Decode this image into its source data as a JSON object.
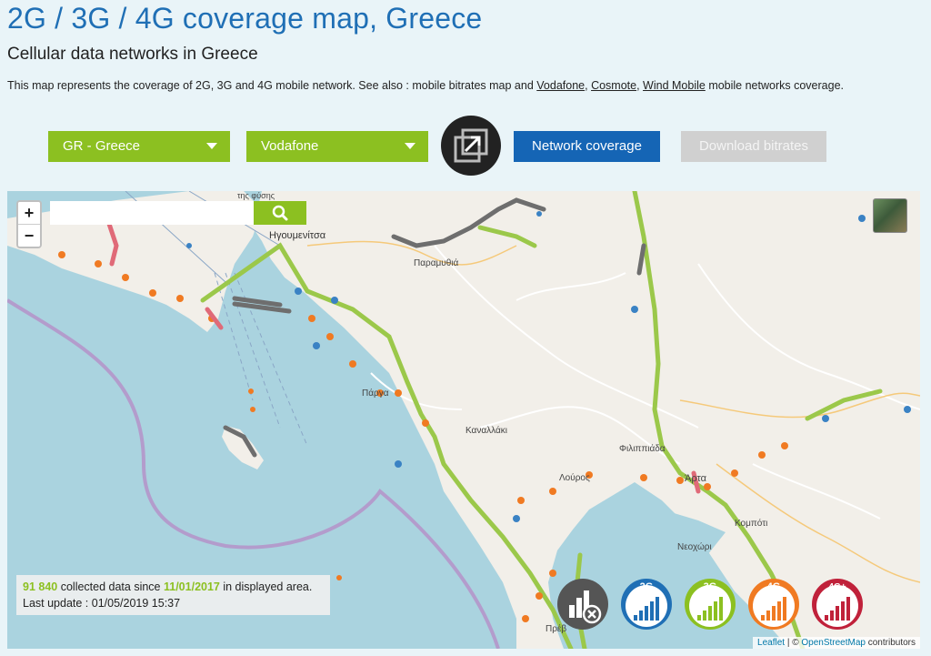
{
  "header": {
    "title": "2G / 3G / 4G coverage map, Greece",
    "subtitle": "Cellular data networks in Greece",
    "intro_text": "This map represents the coverage of 2G, 3G and 4G mobile network. See also : mobile bitrates map and",
    "intro_link_vodafone": "Vodafone",
    "intro_link_cosmote": "Cosmote",
    "intro_link_wind": "Wind Mobile",
    "intro_suffix": "mobile networks coverage."
  },
  "controls": {
    "country": "GR - Greece",
    "operator": "Vodafone",
    "network_coverage_label": "Network coverage",
    "download_bitrates_label": "Download bitrates"
  },
  "map": {
    "zoom_in": "+",
    "zoom_out": "−",
    "search_placeholder": "",
    "places": {
      "igoumenitsa": "Ηγουμενίτσα",
      "paramythia": "Παραμυθιά",
      "parga": "Πάργα",
      "kanallaki": "Καναλλάκι",
      "filippiada": "Φιλιππιάδα",
      "arta": "Άρτα",
      "louros": "Λούρος",
      "kompoti": "Κομπότι",
      "neochori": "Νεοχώρι",
      "preveza": "Πρέβ",
      "tis_fysis": "της φύσης"
    },
    "info": {
      "count": "91 840",
      "collected_text": "collected data since",
      "since_date": "11/01/2017",
      "area_text": "in displayed area.",
      "last_update": "Last update : 01/05/2019 15:37"
    },
    "legend": [
      {
        "label": "2G",
        "color": "#1f6fb5"
      },
      {
        "label": "3G",
        "color": "#8cc021"
      },
      {
        "label": "4G",
        "color": "#f07a22"
      },
      {
        "label": "4G+",
        "color": "#c0213a"
      }
    ],
    "attribution_leaflet": "Leaflet",
    "attribution_osm": "OpenStreetMap",
    "attribution_suffix": "contributors"
  }
}
